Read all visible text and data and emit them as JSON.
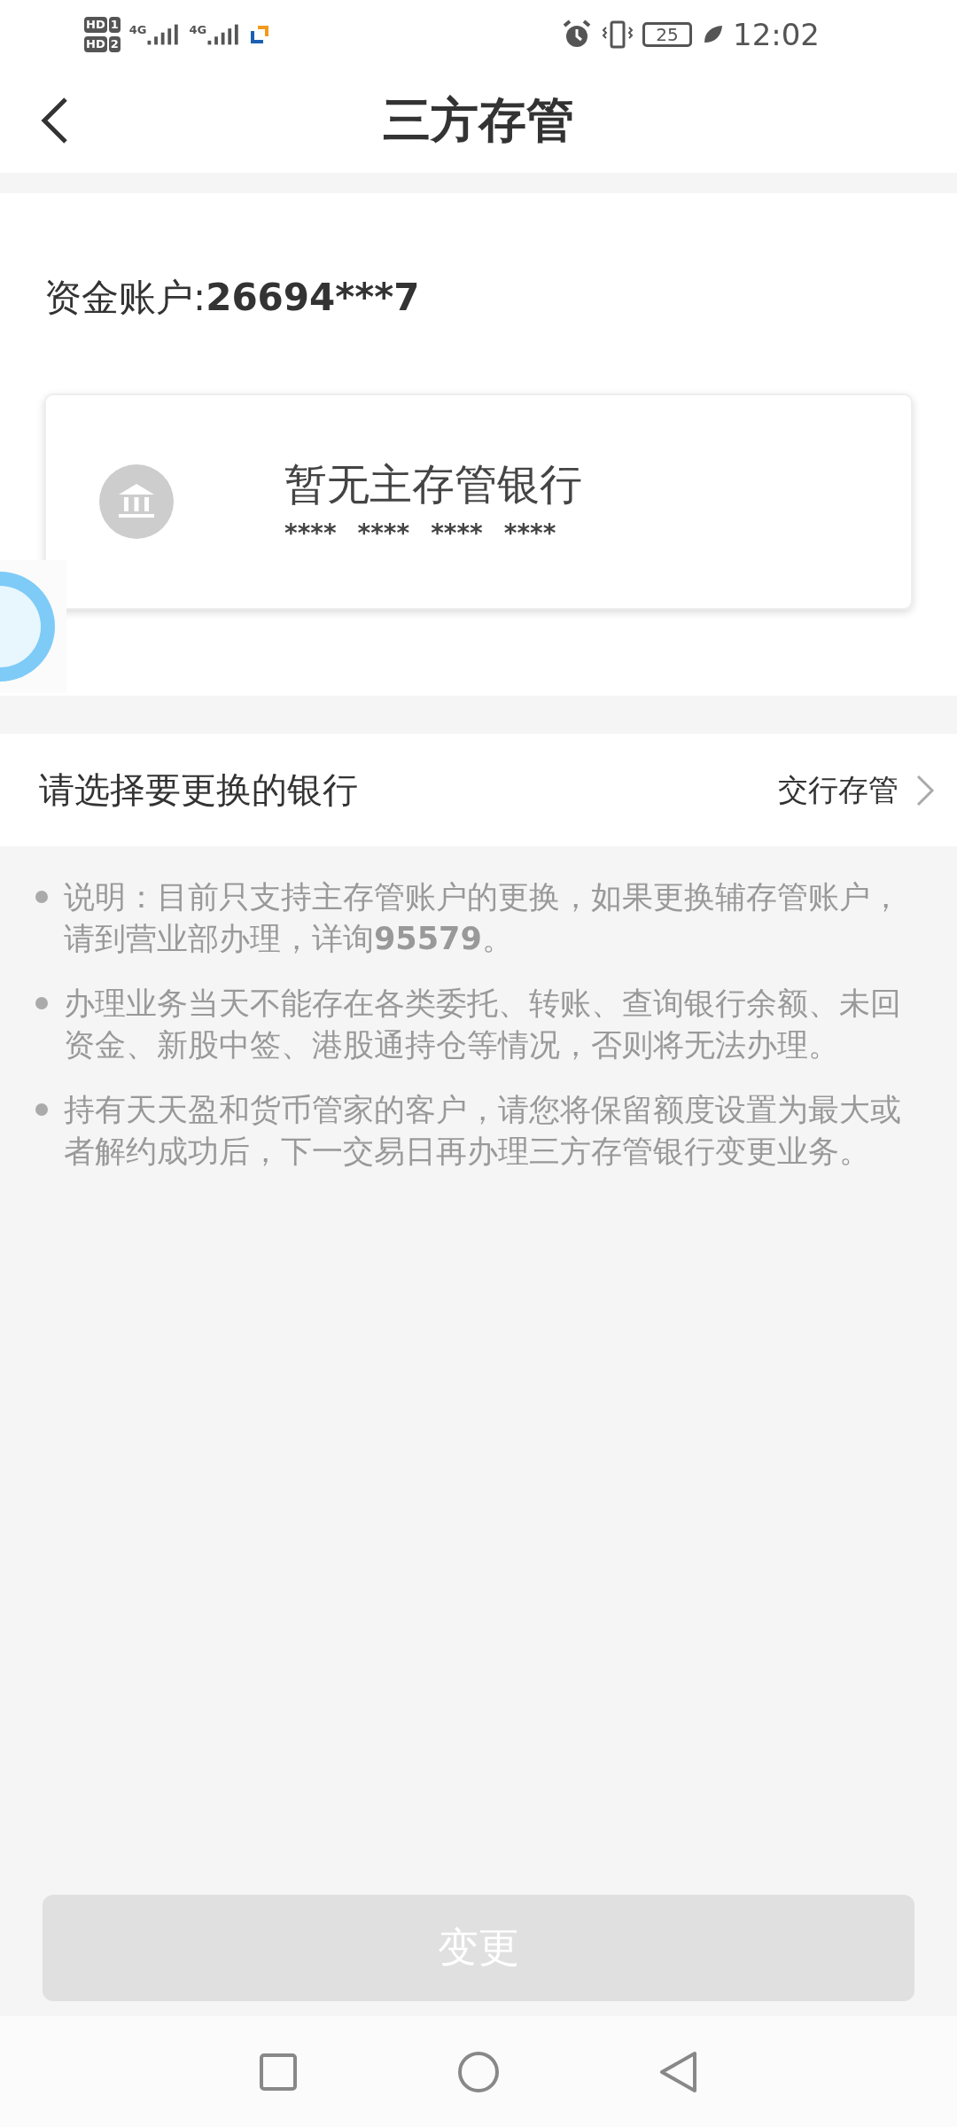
{
  "status_bar": {
    "sims": [
      {
        "badge": "HD",
        "slot": "1",
        "network": "4G"
      },
      {
        "badge": "HD",
        "slot": "2",
        "network": "4G"
      }
    ],
    "battery": "25",
    "time": "12:02"
  },
  "header": {
    "title": "三方存管"
  },
  "account": {
    "label": "资金账户: ",
    "number": "26694***7"
  },
  "bank_card": {
    "name": "暂无主存管银行",
    "card_number": [
      "****",
      "****",
      "****",
      "****"
    ]
  },
  "select_row": {
    "label": "请选择要更换的银行",
    "value": "交行存管"
  },
  "notes": [
    "说明：目前只支持主存管账户的更换，如果更换辅存管账户，请到营业部办理，详询**95579**。",
    "办理业务当天不能存在各类委托、转账、查询银行余额、未回资金、新股中签、港股通持仓等情况，否则将无法办理。",
    "持有天天盈和货币管家的客户，请您将保留额度设置为最大或者解约成功后，下一交易日再办理三方存管银行变更业务。"
  ],
  "submit": {
    "label": "变更",
    "disabled": true
  }
}
